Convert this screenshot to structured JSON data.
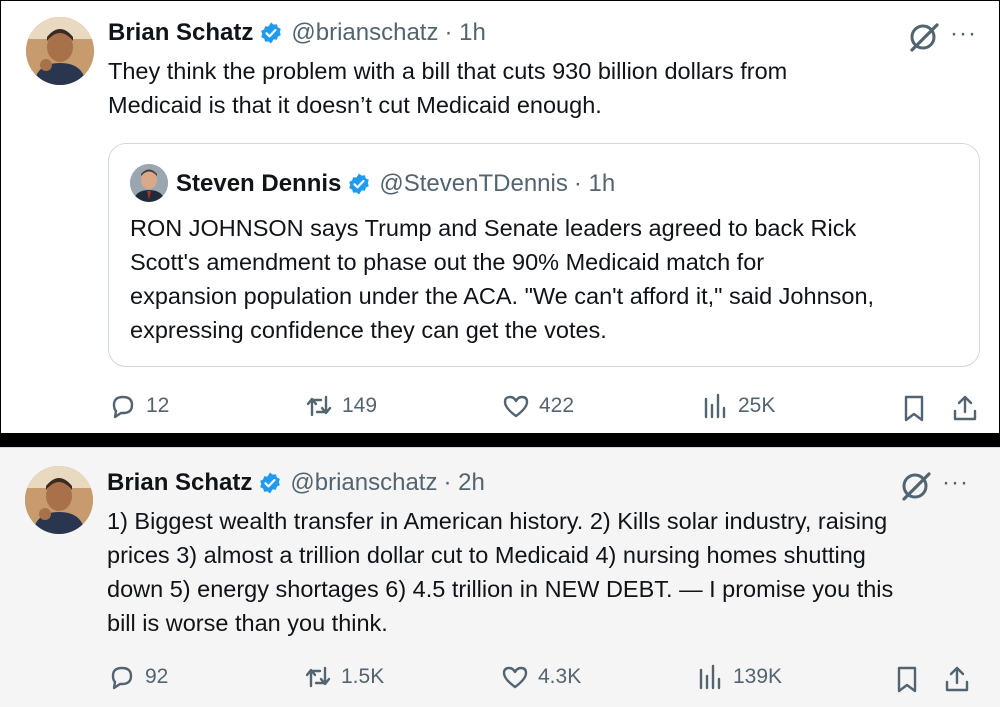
{
  "tweet1": {
    "name": "Brian Schatz",
    "handle": "@brianschatz",
    "time": "· 1h",
    "text": "They think the problem with a bill that cuts 930 billion dollars from\nMedicaid is that it doesn’t cut Medicaid enough.",
    "quote": {
      "name": "Steven Dennis",
      "handle": "@StevenTDennis",
      "time": "· 1h",
      "text": "RON JOHNSON says Trump and Senate leaders agreed to back Rick\nScott's amendment to phase out the 90% Medicaid match for\nexpansion population under the ACA. \"We can't afford it,\" said Johnson,\nexpressing confidence they can get the votes."
    },
    "replies": "12",
    "reposts": "149",
    "likes": "422",
    "views": "25K"
  },
  "tweet2": {
    "name": "Brian Schatz",
    "handle": "@brianschatz",
    "time": "· 2h",
    "text": "1) Biggest wealth transfer in American history. 2) Kills solar industry, raising\nprices 3) almost a trillion dollar cut to Medicaid 4) nursing homes shutting\ndown 5) energy shortages 6) 4.5 trillion in NEW DEBT. — I promise you this\nbill is worse than you think.",
    "replies": "92",
    "reposts": "1.5K",
    "likes": "4.3K",
    "views": "139K"
  },
  "icons": {
    "more": "···",
    "verified_color": "#1d9bf0",
    "muted_color": "#536471"
  }
}
